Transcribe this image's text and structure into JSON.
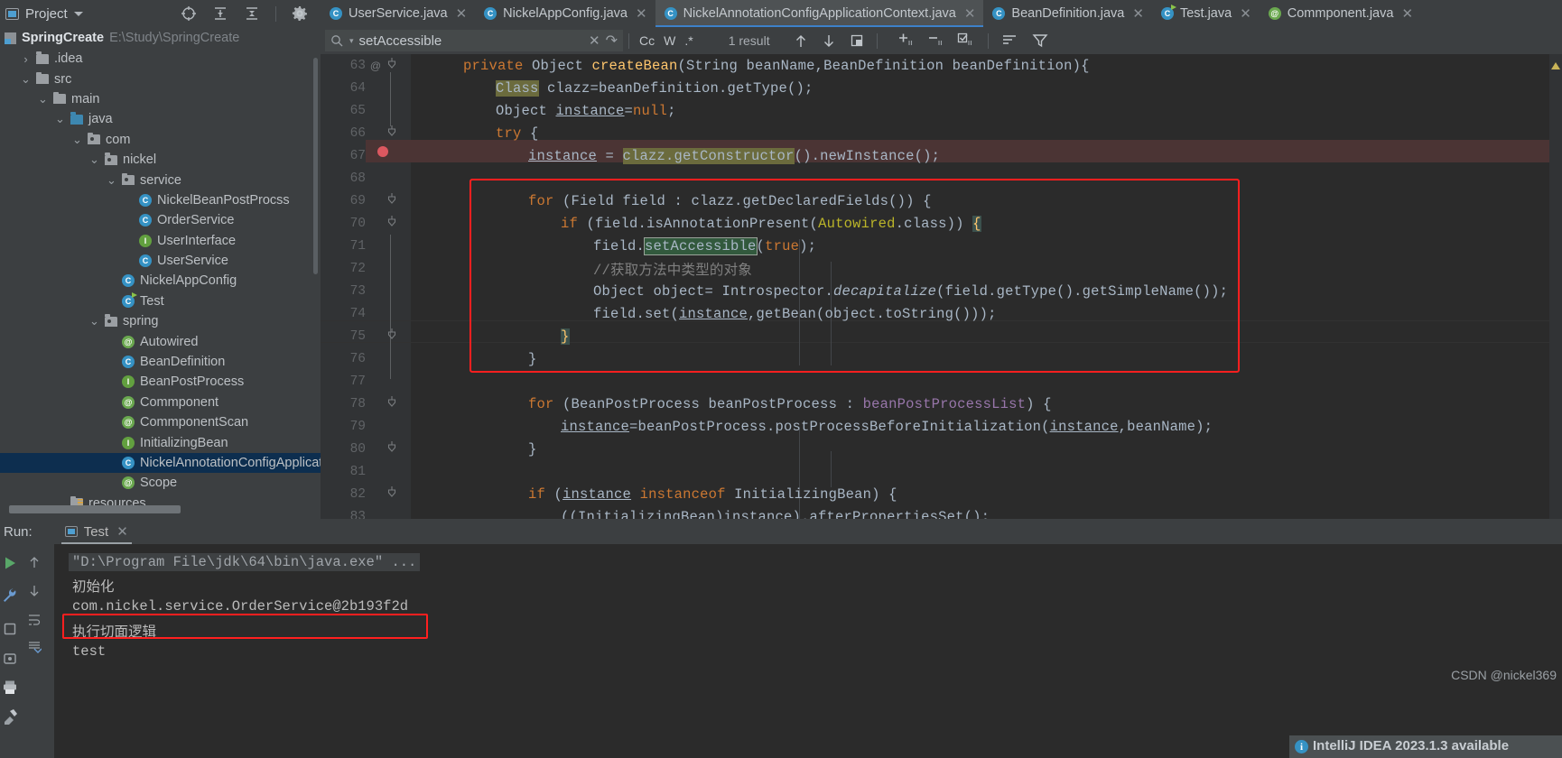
{
  "topbar": {
    "project_label": "Project",
    "icons": [
      "locate-icon",
      "expand-all-icon",
      "collapse-all-icon",
      "settings-gear-icon",
      "minimize-icon"
    ]
  },
  "project": {
    "root_name": "SpringCreate",
    "root_path": "E:\\Study\\SpringCreate",
    "tree": [
      {
        "label": ".idea",
        "indent": 1,
        "kind": "folder",
        "arrow": ">",
        "selected": false
      },
      {
        "label": "src",
        "indent": 1,
        "kind": "folder",
        "arrow": "v",
        "selected": false
      },
      {
        "label": "main",
        "indent": 2,
        "kind": "folder",
        "arrow": "v",
        "selected": false
      },
      {
        "label": "java",
        "indent": 3,
        "kind": "folder-blue",
        "arrow": "v",
        "selected": false
      },
      {
        "label": "com",
        "indent": 4,
        "kind": "package",
        "arrow": "v",
        "selected": false
      },
      {
        "label": "nickel",
        "indent": 5,
        "kind": "package",
        "arrow": "v",
        "selected": false
      },
      {
        "label": "service",
        "indent": 6,
        "kind": "package",
        "arrow": "v",
        "selected": false
      },
      {
        "label": "NickelBeanPostProcss",
        "indent": 7,
        "kind": "class",
        "arrow": "",
        "selected": false
      },
      {
        "label": "OrderService",
        "indent": 7,
        "kind": "class",
        "arrow": "",
        "selected": false
      },
      {
        "label": "UserInterface",
        "indent": 7,
        "kind": "interface",
        "arrow": "",
        "selected": false
      },
      {
        "label": "UserService",
        "indent": 7,
        "kind": "class",
        "arrow": "",
        "selected": false
      },
      {
        "label": "NickelAppConfig",
        "indent": 6,
        "kind": "class",
        "arrow": "",
        "selected": false
      },
      {
        "label": "Test",
        "indent": 6,
        "kind": "runnable",
        "arrow": "",
        "selected": false
      },
      {
        "label": "spring",
        "indent": 5,
        "kind": "package",
        "arrow": "v",
        "selected": false
      },
      {
        "label": "Autowired",
        "indent": 6,
        "kind": "annotation",
        "arrow": "",
        "selected": false
      },
      {
        "label": "BeanDefinition",
        "indent": 6,
        "kind": "class",
        "arrow": "",
        "selected": false
      },
      {
        "label": "BeanPostProcess",
        "indent": 6,
        "kind": "interface",
        "arrow": "",
        "selected": false
      },
      {
        "label": "Commponent",
        "indent": 6,
        "kind": "annotation",
        "arrow": "",
        "selected": false
      },
      {
        "label": "CommponentScan",
        "indent": 6,
        "kind": "annotation",
        "arrow": "",
        "selected": false
      },
      {
        "label": "InitializingBean",
        "indent": 6,
        "kind": "interface",
        "arrow": "",
        "selected": false
      },
      {
        "label": "NickelAnnotationConfigApplicatio",
        "indent": 6,
        "kind": "class",
        "arrow": "",
        "selected": true
      },
      {
        "label": "Scope",
        "indent": 6,
        "kind": "annotation",
        "arrow": "",
        "selected": false
      },
      {
        "label": "resources",
        "indent": 3,
        "kind": "resources",
        "arrow": "",
        "selected": false
      }
    ]
  },
  "tabs": [
    {
      "label": "UserService.java",
      "icon": "class-icon",
      "active": false
    },
    {
      "label": "NickelAppConfig.java",
      "icon": "class-icon",
      "active": false
    },
    {
      "label": "NickelAnnotationConfigApplicationContext.java",
      "icon": "class-icon",
      "active": true
    },
    {
      "label": "BeanDefinition.java",
      "icon": "class-icon",
      "active": false
    },
    {
      "label": "Test.java",
      "icon": "runnable-class-icon",
      "active": false
    },
    {
      "label": "Commponent.java",
      "icon": "annotation-icon",
      "active": false
    }
  ],
  "find": {
    "query": "setAccessible",
    "result_count": "1 result",
    "options": [
      "Cc",
      "W",
      ".*"
    ],
    "actions": [
      "prev-match-icon",
      "next-match-icon",
      "select-all-icon",
      "add-line-icon",
      "remove-line-icon",
      "check-lines-icon",
      "filter-lines-icon",
      "filter-icon"
    ]
  },
  "editor": {
    "first_line": 63,
    "lines": [
      {
        "n": 63,
        "text": "private Object createBean(String beanName,BeanDefinition beanDefinition){",
        "indent": 1
      },
      {
        "n": 64,
        "text": "Class clazz=beanDefinition.getType();",
        "indent": 2
      },
      {
        "n": 65,
        "text": "Object instance=null;",
        "indent": 2
      },
      {
        "n": 66,
        "text": "try {",
        "indent": 2
      },
      {
        "n": 67,
        "text": "instance = clazz.getConstructor().newInstance();",
        "indent": 3
      },
      {
        "n": 68,
        "text": "",
        "indent": 0
      },
      {
        "n": 69,
        "text": "for (Field field : clazz.getDeclaredFields()) {",
        "indent": 3
      },
      {
        "n": 70,
        "text": "if (field.isAnnotationPresent(Autowired.class)) {",
        "indent": 4
      },
      {
        "n": 71,
        "text": "field.setAccessible(true);",
        "indent": 5
      },
      {
        "n": 72,
        "text": "//获取方法中类型的对象",
        "indent": 5
      },
      {
        "n": 73,
        "text": "Object object= Introspector.decapitalize(field.getType().getSimpleName());",
        "indent": 5
      },
      {
        "n": 74,
        "text": "field.set(instance,getBean(object.toString()));",
        "indent": 5
      },
      {
        "n": 75,
        "text": "}",
        "indent": 4
      },
      {
        "n": 76,
        "text": "}",
        "indent": 3
      },
      {
        "n": 77,
        "text": "",
        "indent": 0
      },
      {
        "n": 78,
        "text": "for (BeanPostProcess beanPostProcess : beanPostProcessList) {",
        "indent": 3
      },
      {
        "n": 79,
        "text": "instance=beanPostProcess.postProcessBeforeInitialization(instance,beanName);",
        "indent": 4
      },
      {
        "n": 80,
        "text": "}",
        "indent": 3
      },
      {
        "n": 81,
        "text": "",
        "indent": 0
      },
      {
        "n": 82,
        "text": "if (instance instanceof InitializingBean) {",
        "indent": 3
      },
      {
        "n": 83,
        "text": "((InitializingBean)instance).afterPropertiesSet();",
        "indent": 4
      }
    ],
    "search_highlight": "setAccessible",
    "highlight_color": "#32593d",
    "annotation_gutter_63": "@",
    "breakpoint_line": 67
  },
  "run": {
    "label": "Run:",
    "tab": "Test",
    "console": [
      {
        "text": "\"D:\\Program File\\jdk\\64\\bin\\java.exe\" ...",
        "style": "cmd"
      },
      {
        "text": "初始化",
        "style": "normal"
      },
      {
        "text": "com.nickel.service.OrderService@2b193f2d",
        "style": "highlighted"
      },
      {
        "text": "执行切面逻辑",
        "style": "normal"
      },
      {
        "text": "test",
        "style": "normal"
      }
    ],
    "side_icons": [
      "run-icon",
      "wrench-icon",
      "stop-icon",
      "scroll-up-icon",
      "scroll-down-icon",
      "soft-wrap-icon",
      "scroll-end-icon",
      "print-icon",
      "clear-icon"
    ]
  },
  "notification": {
    "text": "IntelliJ IDEA 2023.1.3 available",
    "icon": "info-icon"
  },
  "watermark": "CSDN @nickel369",
  "colors": {
    "accent": "#3592c4",
    "annotation_badge": "#62a03f",
    "red_highlight_box": "#ff1f1f",
    "selection": "#0d2e4f",
    "editor_bg": "#2b2b2b",
    "panel_bg": "#3c3f41"
  }
}
